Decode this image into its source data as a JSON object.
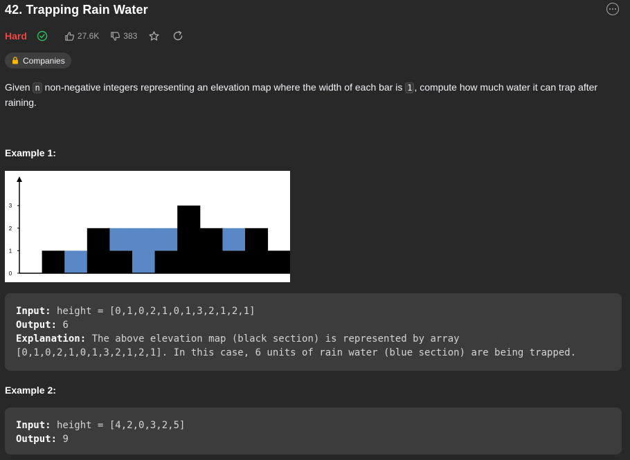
{
  "problem": {
    "title": "42. Trapping Rain Water",
    "difficulty": "Hard",
    "likes": "27.6K",
    "dislikes": "383",
    "companies_label": "Companies",
    "description": {
      "part1": "Given ",
      "code_n": "n",
      "part2": " non-negative integers representing an elevation map where the width of each bar is ",
      "code_1": "1",
      "part3": ", compute how much water it can trap after raining."
    }
  },
  "example1": {
    "title": "Example 1:",
    "input_label": "Input:",
    "input_value": " height = [0,1,0,2,1,0,1,3,2,1,2,1]",
    "output_label": "Output:",
    "output_value": " 6",
    "explanation_label": "Explanation:",
    "explanation_value": " The above elevation map (black section) is represented by array",
    "explanation_line2": "[0,1,0,2,1,0,1,3,2,1,2,1]. In this case, 6 units of rain water (blue section) are being trapped."
  },
  "example2": {
    "title": "Example 2:",
    "input_label": "Input:",
    "input_value": " height = [4,2,0,3,2,5]",
    "output_label": "Output:",
    "output_value": " 9"
  },
  "chart_data": {
    "type": "bar",
    "heights": [
      0,
      1,
      0,
      2,
      1,
      0,
      1,
      3,
      2,
      1,
      2,
      1
    ],
    "water": [
      0,
      0,
      1,
      0,
      1,
      2,
      1,
      0,
      0,
      1,
      0,
      0
    ],
    "yticks": [
      "0",
      "1",
      "2",
      "3"
    ],
    "ylim": [
      0,
      4
    ],
    "bar_color": "#000000",
    "water_color": "#5a87c6"
  },
  "icons": {
    "solved": "check-circle-icon",
    "like": "thumb-up-icon",
    "dislike": "thumb-down-icon",
    "favorite": "star-icon",
    "share": "share-icon",
    "lock": "lock-icon",
    "more": "more-icon"
  }
}
